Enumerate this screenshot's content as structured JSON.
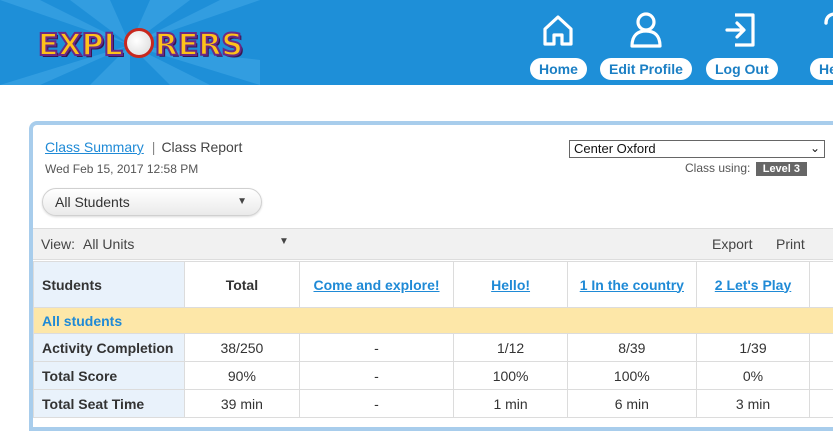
{
  "header": {
    "logo_text": "EXPLORERS",
    "bg_color": "#1e8fd8",
    "nav": [
      {
        "label": "Home",
        "icon": "home-icon"
      },
      {
        "label": "Edit Profile",
        "icon": "user-icon"
      },
      {
        "label": "Log Out",
        "icon": "logout-icon"
      },
      {
        "label": "Help",
        "icon": "help-icon"
      }
    ]
  },
  "panel": {
    "tab_summary": "Class Summary",
    "tab_report": "Class Report",
    "datetime": "Wed Feb 15, 2017 12:58 PM",
    "student_filter": "All Students",
    "class_select": "Center Oxford",
    "class_using_label": "Class using:",
    "level": "Level 3",
    "view_label": "View:",
    "view_value": "All Units",
    "export_label": "Export",
    "print_label": "Print"
  },
  "table": {
    "headers": [
      "Students",
      "Total",
      "Come and explore!",
      "Hello!",
      "1 In the country",
      "2 Let's Play"
    ],
    "group_row": "All students",
    "rows": [
      {
        "label": "Activity Completion",
        "cells": [
          "38/250",
          "-",
          "1/12",
          "8/39",
          "1/39"
        ]
      },
      {
        "label": "Total Score",
        "cells": [
          "90%",
          "-",
          "100%",
          "100%",
          "0%"
        ]
      },
      {
        "label": "Total Seat Time",
        "cells": [
          "39 min",
          "-",
          "1 min",
          "6 min",
          "3 min"
        ]
      }
    ]
  }
}
